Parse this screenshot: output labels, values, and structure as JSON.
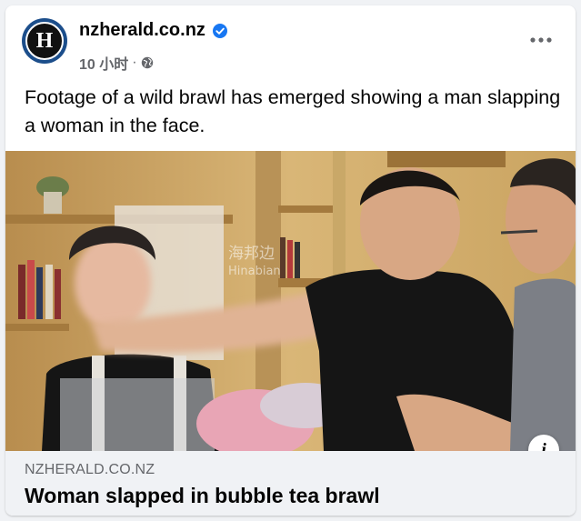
{
  "post": {
    "page_name": "nzherald.co.nz",
    "time": "10 小时",
    "dot": "·",
    "caption": "Footage of a wild brawl has emerged showing a man slapping a woman in the face.",
    "avatar_letter": "H"
  },
  "media": {
    "watermark_cn": "海邦边",
    "watermark_en": "Hinabian"
  },
  "link_preview": {
    "domain": "NZHERALD.CO.NZ",
    "headline": "Woman slapped in bubble tea brawl",
    "info_glyph": "i"
  },
  "icons": {
    "verified": "verified-badge-icon",
    "audience": "globe-icon",
    "more": "more-options-icon",
    "info": "info-icon"
  },
  "colors": {
    "verified_blue": "#1877f2",
    "secondary_text": "#65676b",
    "avatar_ring": "#1c4e8b"
  }
}
